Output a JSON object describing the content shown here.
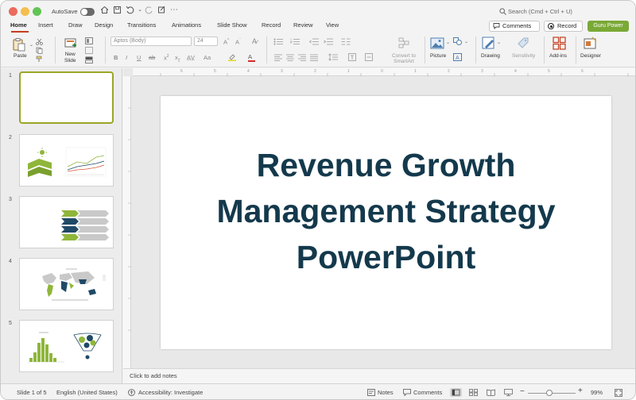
{
  "titlebar": {
    "autosave_label": "AutoSave",
    "search_placeholder": "Search (Cmd + Ctrl + U)"
  },
  "tabs": [
    "Home",
    "Insert",
    "Draw",
    "Design",
    "Transitions",
    "Animations",
    "Slide Show",
    "Record",
    "Review",
    "View"
  ],
  "active_tab": "Home",
  "top_buttons": {
    "comments": "Comments",
    "record": "Record",
    "guru": "Guru Power"
  },
  "ribbon": {
    "paste": "Paste",
    "new_slide_line1": "New",
    "new_slide_line2": "Slide",
    "font_name": "Aptos (Body)",
    "font_size": "24",
    "convert_line1": "Convert to",
    "convert_line2": "SmartArt",
    "picture": "Picture",
    "drawing": "Drawing",
    "sensitivity": "Sensitivity",
    "addins": "Add-ins",
    "designer": "Designer"
  },
  "slides": [
    {
      "number": "1"
    },
    {
      "number": "2"
    },
    {
      "number": "3"
    },
    {
      "number": "4"
    },
    {
      "number": "5"
    }
  ],
  "slide": {
    "title_line1": "Revenue Growth",
    "title_line2": "Management Strategy",
    "title_line3": "PowerPoint"
  },
  "notes_placeholder": "Click to add notes",
  "status": {
    "slide_of": "Slide 1 of 5",
    "language": "English (United States)",
    "accessibility": "Accessibility: Investigate",
    "notes": "Notes",
    "comments": "Comments",
    "zoom": "99%"
  },
  "colors": {
    "accent_tab": "#c43e1c",
    "title_text": "#14394c",
    "guru_button": "#7aa936",
    "thumb_green": "#8fb63a",
    "thumb_navy": "#1f4a66",
    "thumb_gray": "#c9c9c9"
  }
}
